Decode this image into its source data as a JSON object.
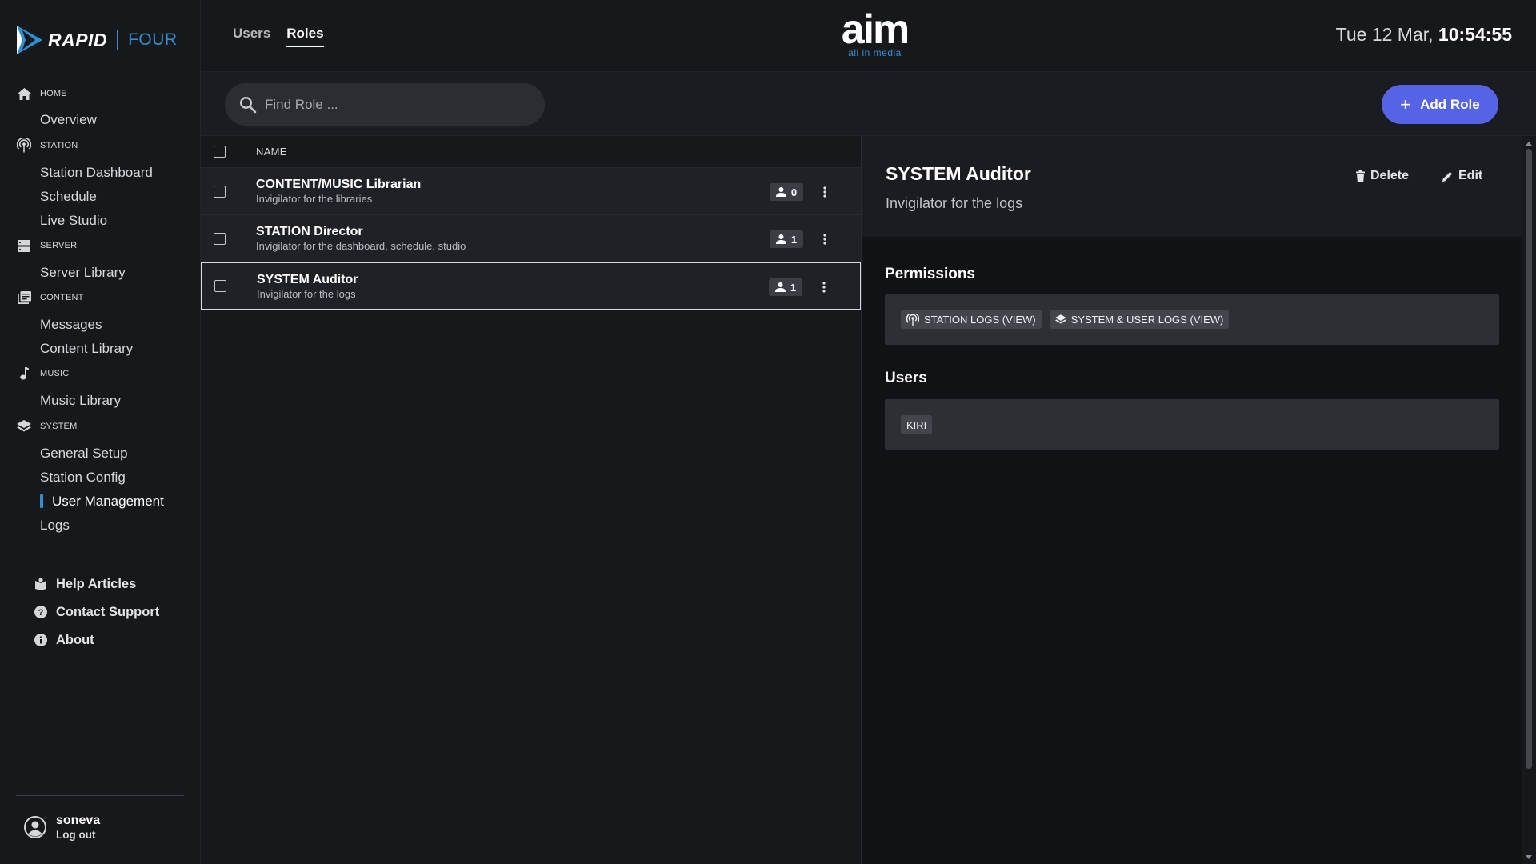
{
  "logo": {
    "word": "RAPID",
    "sub": "FOUR"
  },
  "sidebar": {
    "sections": [
      {
        "key": "home",
        "label": "HOME",
        "icon": "home-icon",
        "items": [
          "Overview"
        ]
      },
      {
        "key": "station",
        "label": "STATION",
        "icon": "broadcast-icon",
        "items": [
          "Station Dashboard",
          "Schedule",
          "Live Studio"
        ]
      },
      {
        "key": "server",
        "label": "SERVER",
        "icon": "server-icon",
        "items": [
          "Server Library"
        ]
      },
      {
        "key": "content",
        "label": "CONTENT",
        "icon": "library-icon",
        "items": [
          "Messages",
          "Content Library"
        ]
      },
      {
        "key": "music",
        "label": "MUSIC",
        "icon": "music-note-icon",
        "items": [
          "Music Library"
        ]
      },
      {
        "key": "system",
        "label": "SYSTEM",
        "icon": "layers-icon",
        "items": [
          "General Setup",
          "Station Config",
          "User Management",
          "Logs"
        ]
      }
    ],
    "active_item": "User Management",
    "help": [
      {
        "label": "Help Articles",
        "icon": "book-icon"
      },
      {
        "label": "Contact Support",
        "icon": "help-circle-icon"
      },
      {
        "label": "About",
        "icon": "info-icon"
      }
    ],
    "user": {
      "name": "soneva",
      "logout": "Log out"
    }
  },
  "header": {
    "tabs": [
      {
        "label": "Users",
        "active": false
      },
      {
        "label": "Roles",
        "active": true
      }
    ],
    "brand": {
      "main": "aim",
      "sub": "all in media"
    },
    "clock": {
      "date": "Tue 12 Mar,",
      "time": "10:54:55"
    }
  },
  "actions": {
    "search_placeholder": "Find Role ...",
    "add_label": "Add Role"
  },
  "list": {
    "column_name": "NAME",
    "rows": [
      {
        "title": "CONTENT/MUSIC Librarian",
        "desc": "Invigilator for the libraries",
        "count": "0",
        "selected": false
      },
      {
        "title": "STATION Director",
        "desc": "Invigilator for the dashboard, schedule, studio",
        "count": "1",
        "selected": false
      },
      {
        "title": "SYSTEM Auditor",
        "desc": "Invigilator for the logs",
        "count": "1",
        "selected": true
      }
    ]
  },
  "detail": {
    "title": "SYSTEM Auditor",
    "subtitle": "Invigilator for the logs",
    "delete_label": "Delete",
    "edit_label": "Edit",
    "permissions_title": "Permissions",
    "permissions": [
      {
        "label": "STATION LOGS (VIEW)",
        "icon": "broadcast-icon"
      },
      {
        "label": "SYSTEM & USER LOGS (VIEW)",
        "icon": "layers-icon"
      }
    ],
    "users_title": "Users",
    "users": [
      "KIRI"
    ]
  },
  "colors": {
    "accent": "#5563e6",
    "brand_blue": "#2f8fd0",
    "background": "#17181c"
  }
}
